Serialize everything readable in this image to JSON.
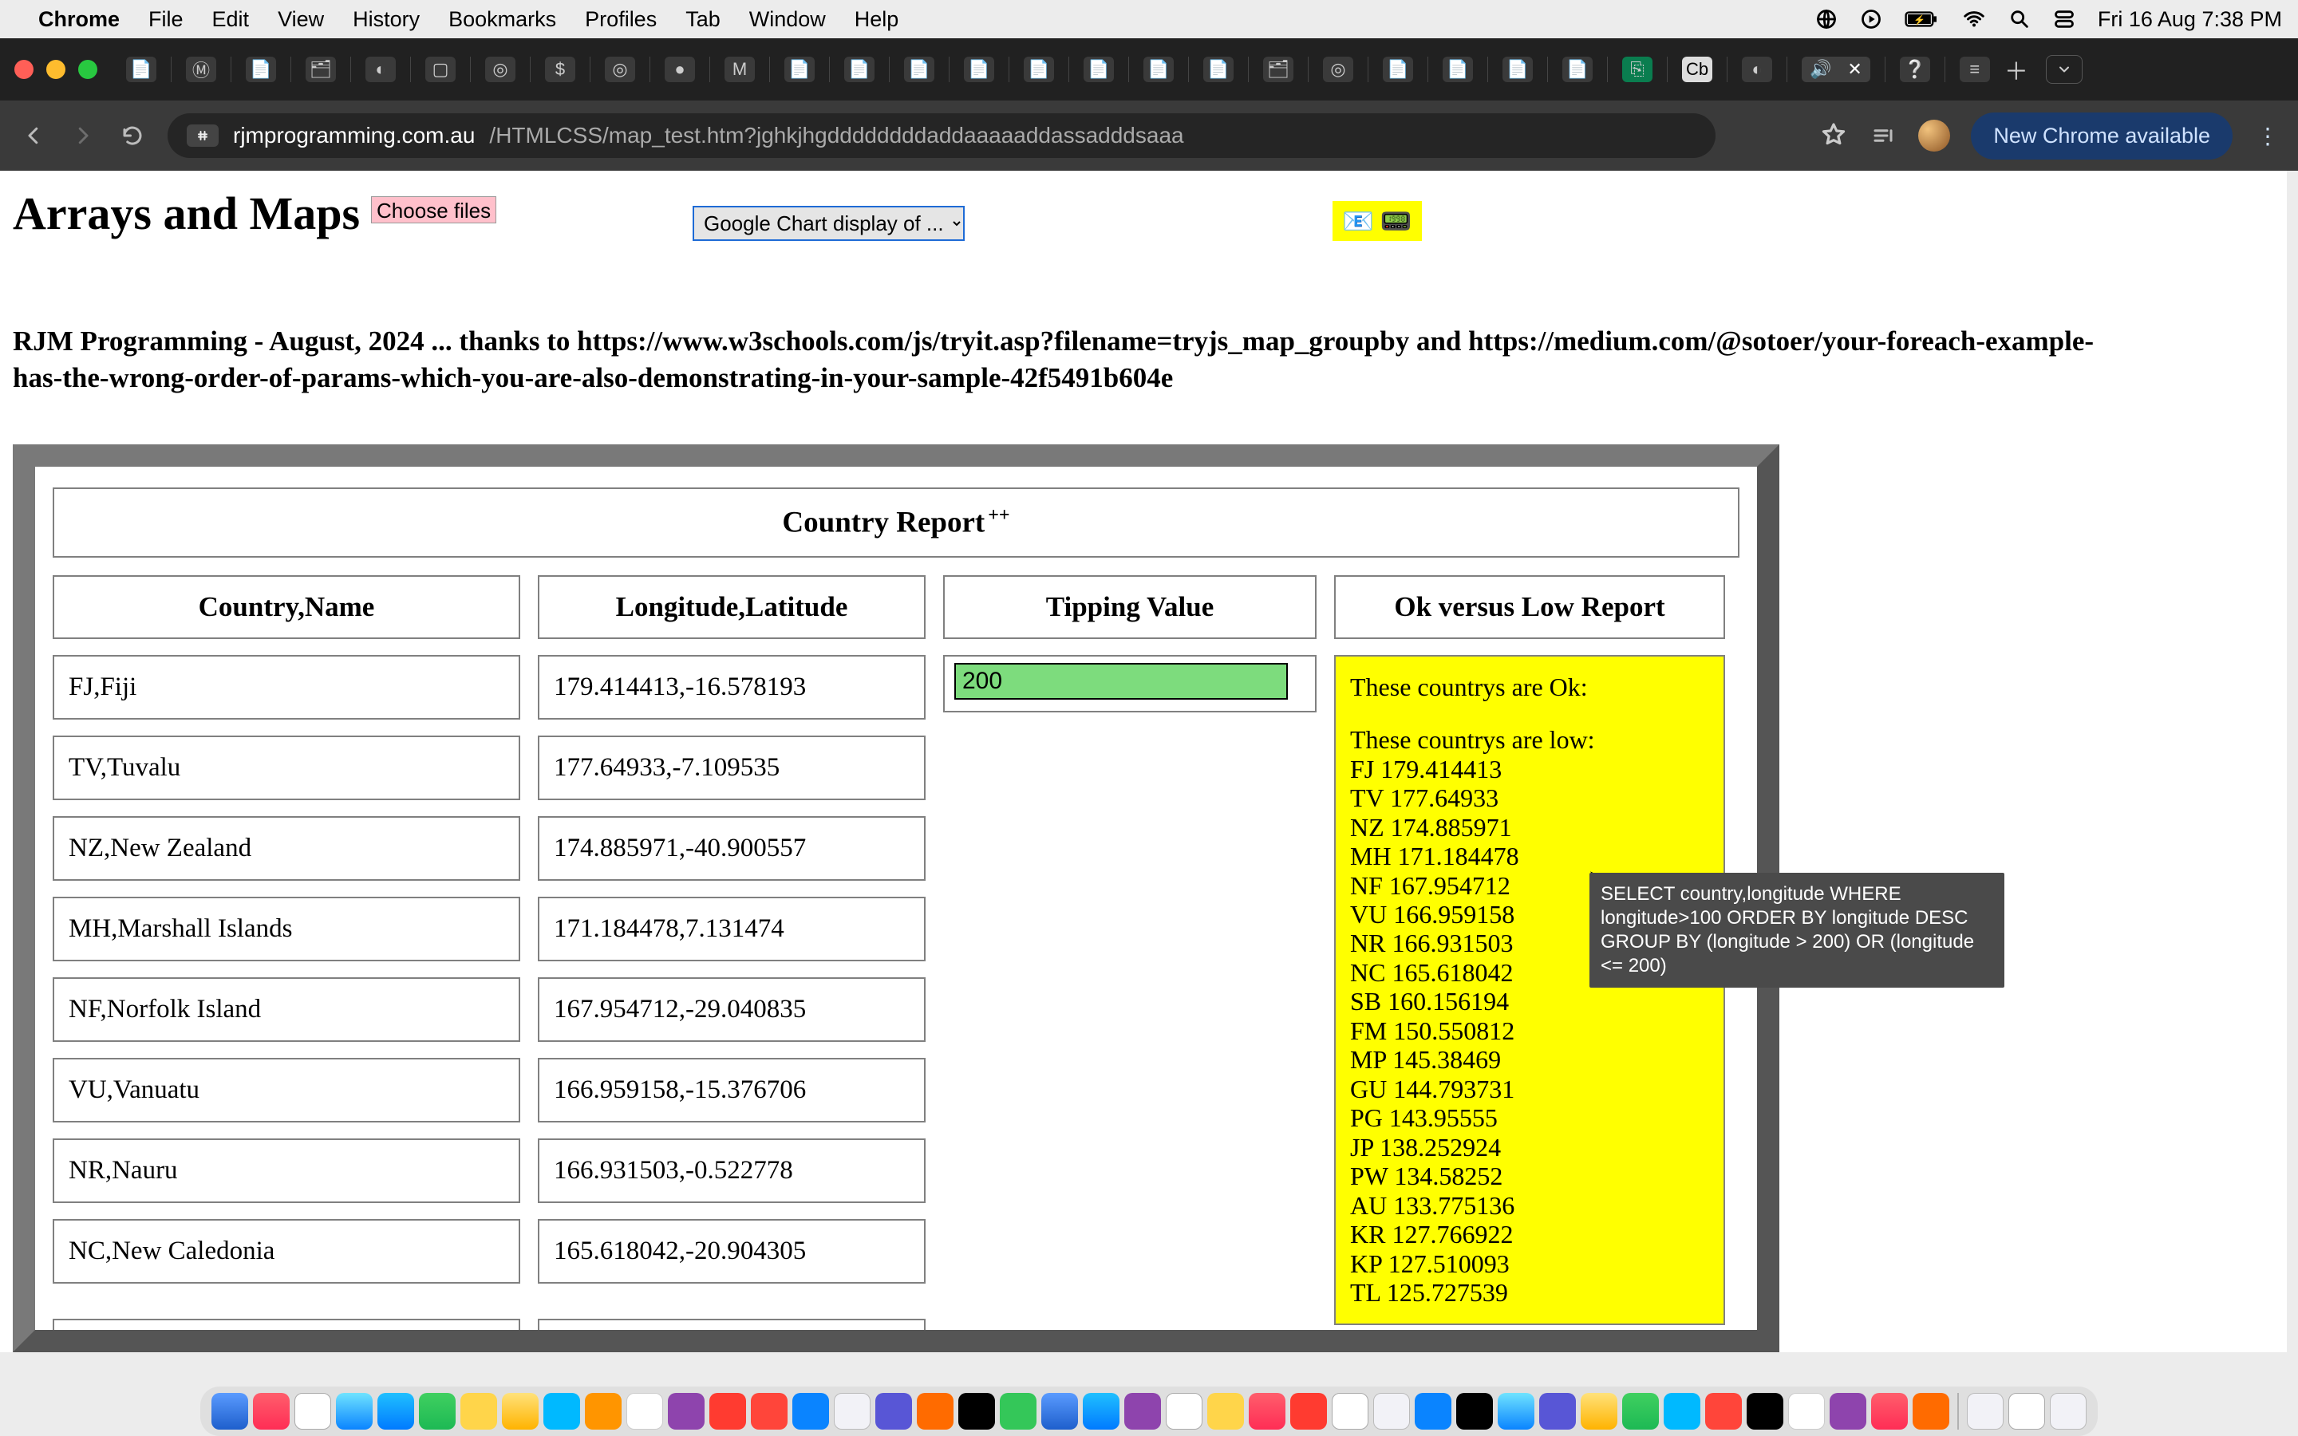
{
  "menubar": {
    "app": "Chrome",
    "items": [
      "File",
      "Edit",
      "View",
      "History",
      "Bookmarks",
      "Profiles",
      "Tab",
      "Window",
      "Help"
    ],
    "clock": "Fri 16 Aug  7:38 PM"
  },
  "chrome": {
    "url_domain": "rjmprogramming.com.au",
    "url_path": "/HTMLCSS/map_test.htm?jghkjhgddddddddaddaaaaaddassadddsaaa",
    "update_label": "New Chrome available"
  },
  "page": {
    "title": "Arrays and Maps",
    "choose_files": "Choose files",
    "gc_select": "Google Chart display of ...",
    "emoji_box": "📧 📟",
    "credits": "RJM Programming - August, 2024 ... thanks to https://www.w3schools.com/js/tryit.asp?filename=tryjs_map_groupby and https://medium.com/@sotoer/your-foreach-example-has-the-wrong-order-of-params-which-you-are-also-demonstrating-in-your-sample-42f5491b604e"
  },
  "report": {
    "title": "Country Report",
    "title_sup": "++",
    "headers": {
      "country": "Country,Name",
      "lonlat": "Longitude,Latitude",
      "tipping": "Tipping Value",
      "okvslow": "Ok versus Low Report"
    },
    "rows": [
      {
        "country": "FJ,Fiji",
        "lonlat": "179.414413,-16.578193"
      },
      {
        "country": "TV,Tuvalu",
        "lonlat": "177.64933,-7.109535"
      },
      {
        "country": "NZ,New Zealand",
        "lonlat": "174.885971,-40.900557"
      },
      {
        "country": "MH,Marshall Islands",
        "lonlat": "171.184478,7.131474"
      },
      {
        "country": "NF,Norfolk Island",
        "lonlat": "167.954712,-29.040835"
      },
      {
        "country": "VU,Vanuatu",
        "lonlat": "166.959158,-15.376706"
      },
      {
        "country": "NR,Nauru",
        "lonlat": "166.931503,-0.522778"
      },
      {
        "country": "NC,New Caledonia",
        "lonlat": "165.618042,-20.904305"
      }
    ],
    "tipping_value": "200",
    "ok_header": "These countrys are Ok:",
    "low_header": "These countrys are low:",
    "low_list": [
      "FJ 179.414413",
      "TV 177.64933",
      "NZ 174.885971",
      "MH 171.184478",
      "NF 167.954712",
      "VU 166.959158",
      "NR 166.931503",
      "NC 165.618042",
      "SB 160.156194",
      "FM 150.550812",
      "MP 145.38469",
      "GU 144.793731",
      "PG 143.95555",
      "JP 138.252924",
      "PW 134.58252",
      "AU 133.775136",
      "KR 127.766922",
      "KP 127.510093",
      "TL 125.727539"
    ]
  },
  "tooltip": "SELECT country,longitude WHERE longitude>100  ORDER BY longitude DESC GROUP BY (longitude >   200) OR  (longitude <=   200)"
}
